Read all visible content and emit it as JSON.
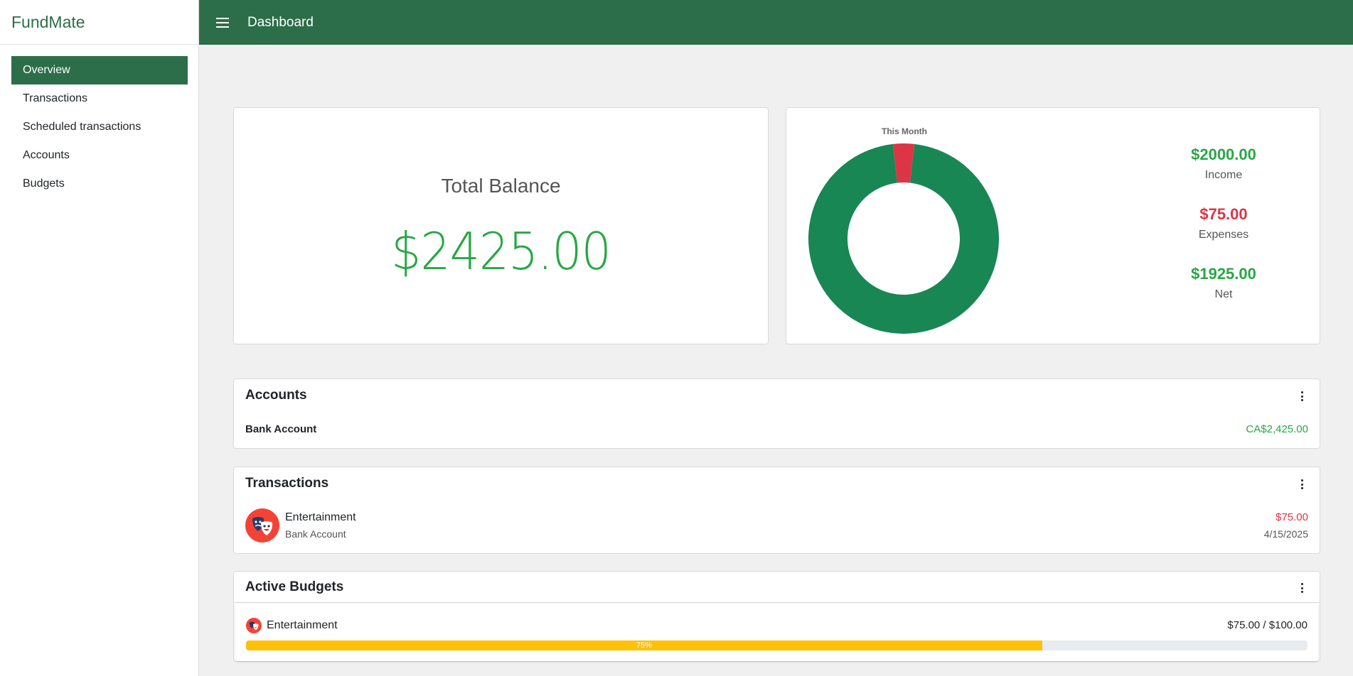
{
  "app": {
    "name": "FundMate"
  },
  "sidebar": {
    "items": [
      {
        "label": "Overview",
        "active": true
      },
      {
        "label": "Transactions"
      },
      {
        "label": "Scheduled transactions"
      },
      {
        "label": "Accounts"
      },
      {
        "label": "Budgets"
      }
    ]
  },
  "header": {
    "title": "Dashboard",
    "menu_icon": "hamburger-icon"
  },
  "balance": {
    "title": "Total Balance",
    "value": "$2425.00"
  },
  "month": {
    "label": "This Month",
    "income_value": "$2000.00",
    "income_label": "Income",
    "expenses_value": "$75.00",
    "expenses_label": "Expenses",
    "net_value": "$1925.00",
    "net_label": "Net"
  },
  "chart_data": {
    "type": "pie",
    "title": "This Month",
    "donut": true,
    "categories": [
      "Income",
      "Expenses"
    ],
    "values": [
      2000,
      75
    ],
    "colors": [
      "#198754",
      "#dc3545"
    ]
  },
  "accounts": {
    "title": "Accounts",
    "rows": [
      {
        "name": "Bank Account",
        "balance": "CA$2,425.00"
      }
    ]
  },
  "transactions": {
    "title": "Transactions",
    "rows": [
      {
        "category": "Entertainment",
        "account": "Bank Account",
        "amount": "$75.00",
        "date": "4/15/2025",
        "icon": "theater-masks-icon"
      }
    ]
  },
  "budgets": {
    "title": "Active Budgets",
    "rows": [
      {
        "name": "Entertainment",
        "amount": "$75.00 / $100.00",
        "progress": 75,
        "progress_label": "75%",
        "icon": "theater-masks-icon"
      }
    ]
  },
  "colors": {
    "brand": "#2c6e49",
    "income": "#28a745",
    "expense": "#dc3545",
    "progress": "#ffc107"
  }
}
